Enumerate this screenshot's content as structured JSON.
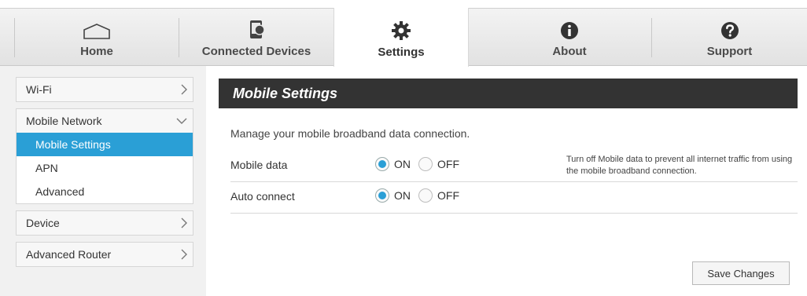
{
  "nav": {
    "tabs": [
      {
        "label": "Home",
        "icon": "home-icon"
      },
      {
        "label": "Connected Devices",
        "icon": "device-icon"
      },
      {
        "label": "Settings",
        "icon": "gear-icon",
        "active": true
      },
      {
        "label": "About",
        "icon": "info-icon"
      },
      {
        "label": "Support",
        "icon": "question-icon"
      }
    ]
  },
  "sidebar": {
    "wifi": "Wi-Fi",
    "mobile_network": "Mobile Network",
    "mobile_settings": "Mobile Settings",
    "apn": "APN",
    "advanced": "Advanced",
    "device": "Device",
    "advanced_router": "Advanced Router"
  },
  "main": {
    "title": "Mobile Settings",
    "description": "Manage your mobile broadband data connection.",
    "mobile_data": {
      "label": "Mobile data",
      "on_label": "ON",
      "off_label": "OFF",
      "value": "ON",
      "hint": "Turn off Mobile data to prevent all internet traffic from using the mobile broadband connection."
    },
    "auto_connect": {
      "label": "Auto connect",
      "on_label": "ON",
      "off_label": "OFF",
      "value": "ON"
    },
    "save_label": "Save Changes"
  },
  "colors": {
    "accent": "#2a9fd6",
    "title_bar": "#333333"
  }
}
